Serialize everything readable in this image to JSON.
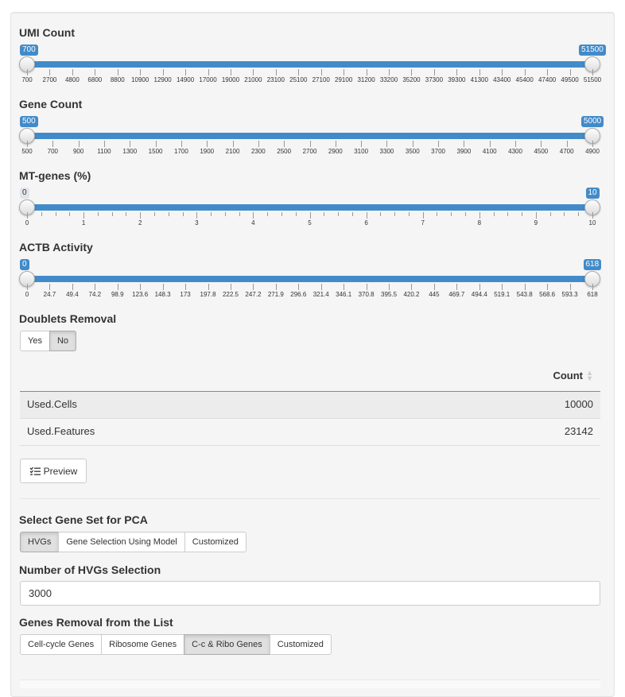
{
  "sliders": [
    {
      "id": "umi",
      "label": "UMI Count",
      "min_badge": "700",
      "max_badge": "51500",
      "min_grey": false,
      "ticks": [
        "700",
        "2700",
        "4800",
        "6800",
        "8800",
        "10900",
        "12900",
        "14900",
        "17000",
        "19000",
        "21000",
        "23100",
        "25100",
        "27100",
        "29100",
        "31200",
        "33200",
        "35200",
        "37300",
        "39300",
        "41300",
        "43400",
        "45400",
        "47400",
        "49500",
        "51500"
      ]
    },
    {
      "id": "gene",
      "label": "Gene Count",
      "min_badge": "500",
      "max_badge": "5000",
      "min_grey": false,
      "ticks": [
        "500",
        "700",
        "900",
        "1100",
        "1300",
        "1500",
        "1700",
        "1900",
        "2100",
        "2300",
        "2500",
        "2700",
        "2900",
        "3100",
        "3300",
        "3500",
        "3700",
        "3900",
        "4100",
        "4300",
        "4500",
        "4700",
        "4900"
      ]
    },
    {
      "id": "mt",
      "label": "MT-genes (%)",
      "min_badge": "0",
      "max_badge": "10",
      "min_grey": true,
      "ticks": [
        "0",
        "1",
        "2",
        "3",
        "4",
        "5",
        "6",
        "7",
        "8",
        "9",
        "10"
      ]
    },
    {
      "id": "actb",
      "label": "ACTB Activity",
      "min_badge": "0",
      "max_badge": "618",
      "min_grey": false,
      "ticks": [
        "0",
        "24.7",
        "49.4",
        "74.2",
        "98.9",
        "123.6",
        "148.3",
        "173",
        "197.8",
        "222.5",
        "247.2",
        "271.9",
        "296.6",
        "321.4",
        "346.1",
        "370.8",
        "395.5",
        "420.2",
        "445",
        "469.7",
        "494.4",
        "519.1",
        "543.8",
        "568.6",
        "593.3",
        "618"
      ]
    }
  ],
  "doublets": {
    "label": "Doublets Removal",
    "options": [
      "Yes",
      "No"
    ],
    "selected": "No"
  },
  "table": {
    "header": "Count",
    "rows": [
      {
        "name": "Used.Cells",
        "value": "10000"
      },
      {
        "name": "Used.Features",
        "value": "23142"
      }
    ]
  },
  "preview_label": "Preview",
  "gene_set": {
    "label": "Select Gene Set for PCA",
    "options": [
      "HVGs",
      "Gene Selection Using Model",
      "Customized"
    ],
    "selected": "HVGs"
  },
  "hvg": {
    "label": "Number of HVGs Selection",
    "value": "3000"
  },
  "removal": {
    "label": "Genes Removal from the List",
    "options": [
      "Cell-cycle Genes",
      "Ribosome Genes",
      "C-c & Ribo Genes",
      "Customized"
    ],
    "selected": "C-c & Ribo Genes"
  },
  "colors": {
    "accent": "#428bca",
    "panel": "#f5f5f5"
  }
}
